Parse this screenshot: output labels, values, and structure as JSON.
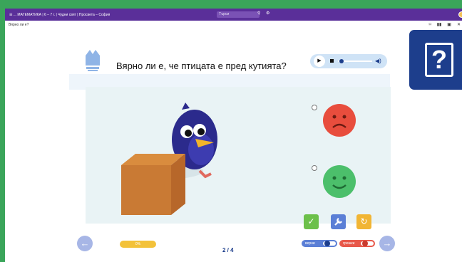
{
  "topbar": {
    "menu_icon": "hamburger-icon",
    "breadcrumbs": "☰ ... МАТЕМАТИКА | 6 – 7 г. | Чудни свят | Просвета – София",
    "search_placeholder": "Търси",
    "search_icon": "search-icon",
    "settings_icon": "gear-icon"
  },
  "subbar": {
    "title": "Вярно ли е?"
  },
  "question": "Вярно ли е, че птицата е пред кутията?",
  "player": {
    "play": "▶",
    "volume": "◀)"
  },
  "answers": [
    {
      "kind": "sad",
      "color": "#e84d3d"
    },
    {
      "kind": "happy",
      "color": "#4cbf6b"
    }
  ],
  "controls": {
    "check_color": "#6cc04a",
    "hint_color": "#5b7fd6",
    "retry_color": "#f1b534"
  },
  "progress": {
    "label": "0%",
    "value": 0
  },
  "pagination": {
    "label": "2 / 4"
  },
  "toggles": {
    "correct_label": "верни",
    "wrong_label": "грешки"
  },
  "colors": {
    "brand": "#5a2f99",
    "background": "#3aa55a",
    "help": "#1d3e8c"
  }
}
